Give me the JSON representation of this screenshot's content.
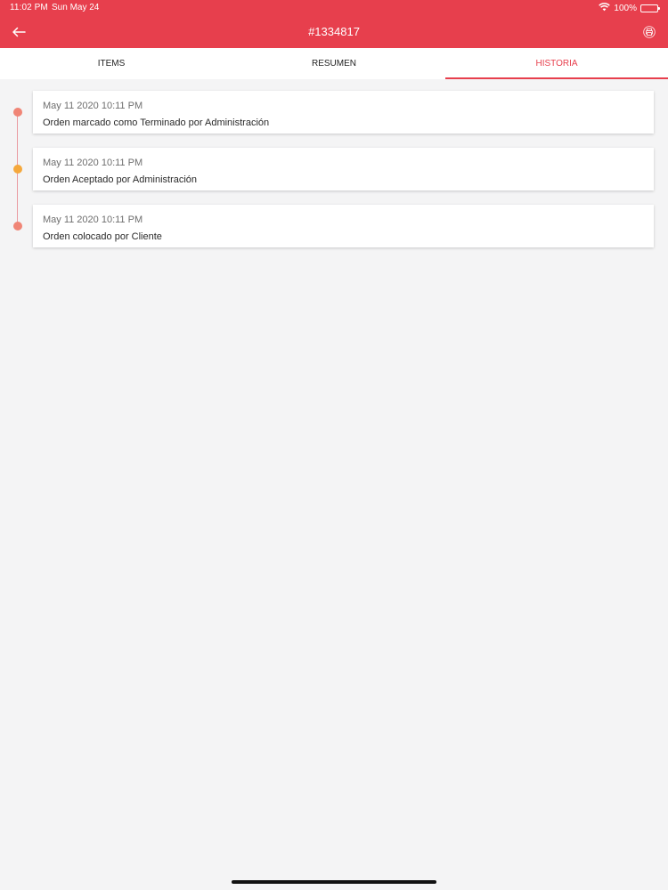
{
  "status_bar": {
    "time": "11:02 PM",
    "date": "Sun May 24",
    "battery": "100%",
    "battery_level": 1.0
  },
  "header": {
    "title": "#1334817",
    "back_icon": "arrow-left-icon",
    "print_icon": "printer-icon",
    "background_color": "#e73f4d"
  },
  "tabs": [
    {
      "label": "ITEMS",
      "active": false
    },
    {
      "label": "RESUMEN",
      "active": false
    },
    {
      "label": "HISTORIA",
      "active": true
    }
  ],
  "history": [
    {
      "date": "May 11 2020 10:11 PM",
      "text": "Orden marcado como Terminado por Administración",
      "dot_color": "#f08576"
    },
    {
      "date": "May 11 2020 10:11 PM",
      "text": "Orden Aceptado por Administración",
      "dot_color": "#f5a83c"
    },
    {
      "date": "May 11 2020 10:11 PM",
      "text": "Orden colocado por Cliente",
      "dot_color": "#f08576"
    }
  ],
  "colors": {
    "accent": "#e73f4d",
    "background": "#f4f4f5",
    "timeline_line": "#e99aa0"
  }
}
